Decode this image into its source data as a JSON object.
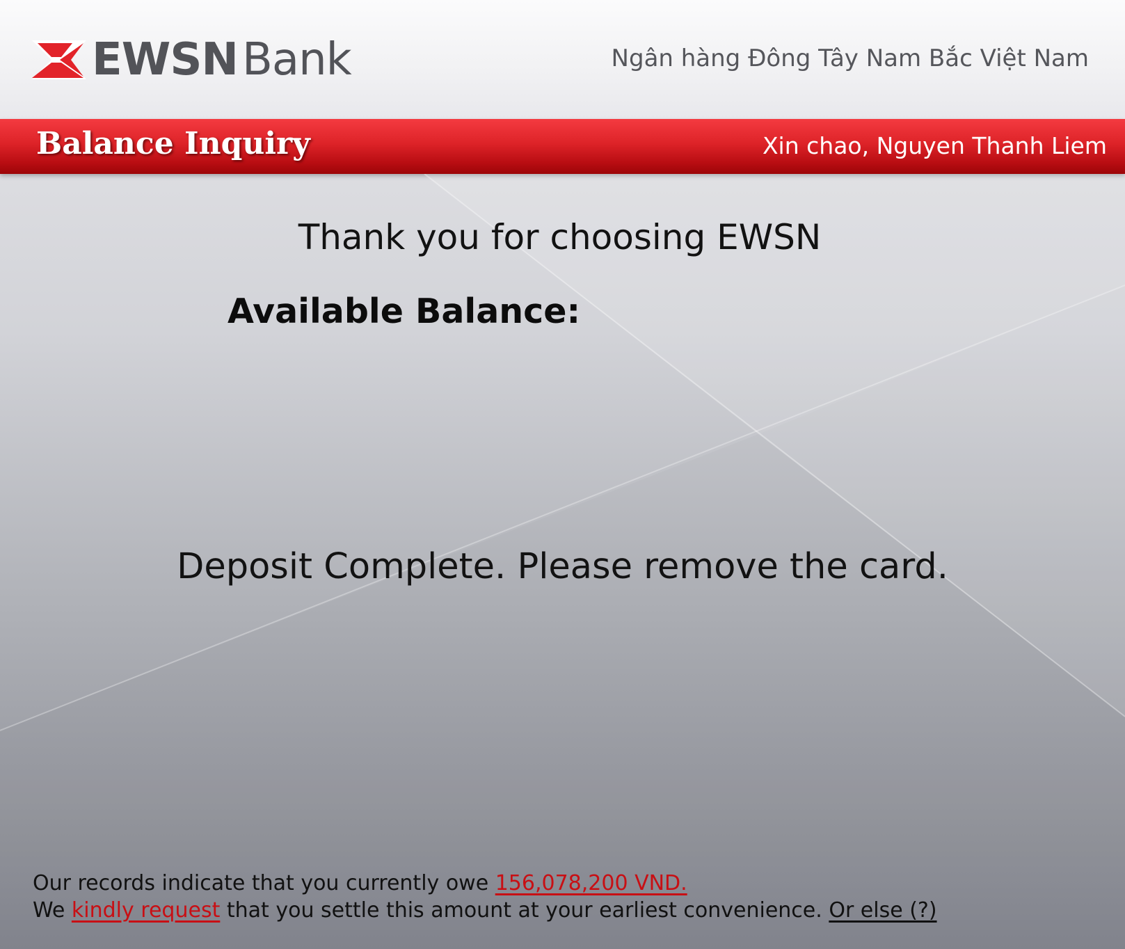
{
  "header": {
    "logo_ewsn": "EWSN",
    "logo_bank": "Bank",
    "bank_fullname": "Ngân hàng Đông Tây Nam Bắc Việt Nam"
  },
  "title_bar": {
    "title": "Balance Inquiry",
    "greeting": "Xin chao, Nguyen Thanh Liem"
  },
  "main": {
    "thanks": "Thank you for choosing EWSN",
    "balance_label": "Available Balance:",
    "deposit_message": "Deposit Complete. Please remove the card."
  },
  "notice": {
    "line1_text": "Our records indicate that you currently owe ",
    "amount_owed": "156,078,200 VND.",
    "line2_prefix": "We ",
    "kindly_request": "kindly request",
    "line2_middle": " that you settle this amount at your earliest convenience. ",
    "or_else": "Or else (?)"
  },
  "colors": {
    "brand_red": "#dd2328",
    "link_red": "#c80f14",
    "logo_gray": "#525358"
  }
}
